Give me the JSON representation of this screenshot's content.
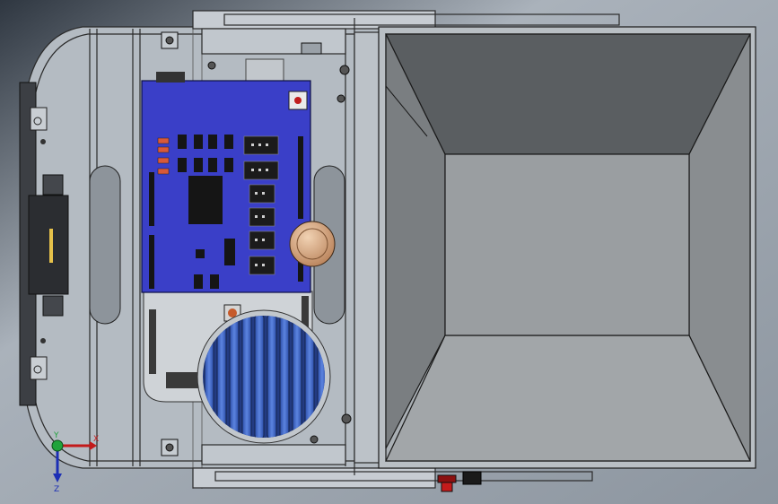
{
  "scene": {
    "background_top": "#3f4852",
    "background_mid": "#b8bfc7",
    "background_right": "#9aa3ad",
    "part_edge": "#1e1e1e",
    "board_blue": "#3a3fc8",
    "fan_blue": "#3f67c8",
    "hopper_inner": "#8f9396",
    "hopper_bottom": "#9ea2a4",
    "hopper_left": "#6f7376",
    "hopper_top": "#5a5e61"
  },
  "icons": {
    "triad": "coordinate-triad-icon",
    "button_red": "red-push-button-icon",
    "button_black": "black-push-button-icon"
  },
  "triad": {
    "x_label": "X",
    "y_label": "Y",
    "z_label": "Z"
  }
}
